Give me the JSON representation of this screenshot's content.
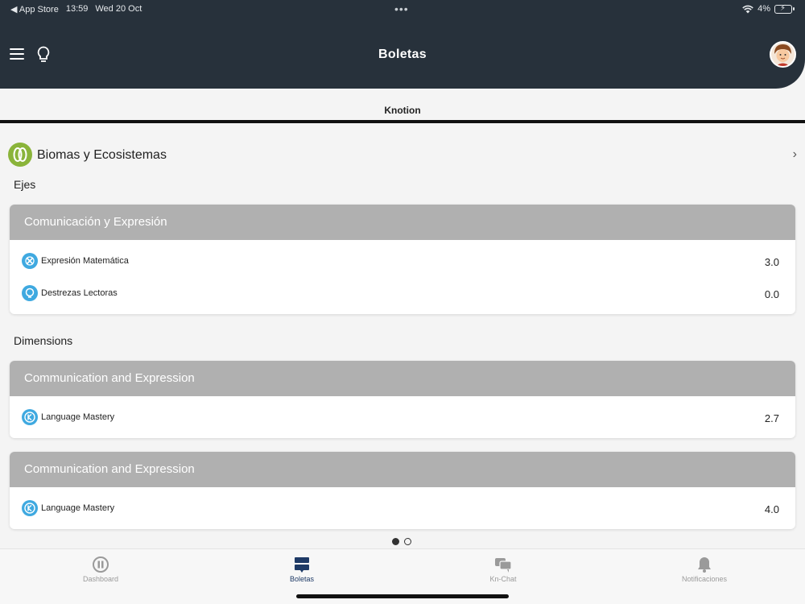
{
  "status_bar": {
    "back_app": "◀ App Store",
    "time": "13:59",
    "date": "Wed 20 Oct",
    "dots": "•••",
    "battery": "4%"
  },
  "header": {
    "title": "Boletas"
  },
  "tabs": {
    "active": "Knotion"
  },
  "subject": {
    "title": "Biomas y Ecosistemas",
    "chevron": "›",
    "icon": "knotion-subject-icon"
  },
  "sections": {
    "ejes_label": "Ejes",
    "dimensions_label": "Dimensions"
  },
  "ejes_card": {
    "title": "Comunicación y Expresión",
    "items": [
      {
        "label": "Expresión Matemática",
        "value": "3.0",
        "icon": "math-expression-icon"
      },
      {
        "label": "Destrezas Lectoras",
        "value": "0.0",
        "icon": "reading-skills-icon"
      }
    ]
  },
  "dimension_cards": [
    {
      "title": "Communication and Expression",
      "items": [
        {
          "label": "Language Mastery",
          "value": "2.7",
          "icon": "language-mastery-icon"
        }
      ]
    },
    {
      "title": "Communication and Expression",
      "items": [
        {
          "label": "Language Mastery",
          "value": "4.0",
          "icon": "language-mastery-icon"
        }
      ]
    }
  ],
  "pager": {
    "pages": 2,
    "active": 1
  },
  "bottom_nav": [
    {
      "label": "Dashboard",
      "icon": "dashboard-icon",
      "active": false
    },
    {
      "label": "Boletas",
      "icon": "report-cards-icon",
      "active": true
    },
    {
      "label": "Kn-Chat",
      "icon": "chat-icon",
      "active": false
    },
    {
      "label": "Notificaciones",
      "icon": "bell-icon",
      "active": false
    }
  ],
  "colors": {
    "header_bg": "#27313b",
    "subject_icon": "#8ab43a",
    "item_icon": "#3fa9e0",
    "card_header": "#b0b0b0",
    "nav_active": "#1e3a66",
    "nav_inactive": "#9a9a9a"
  }
}
